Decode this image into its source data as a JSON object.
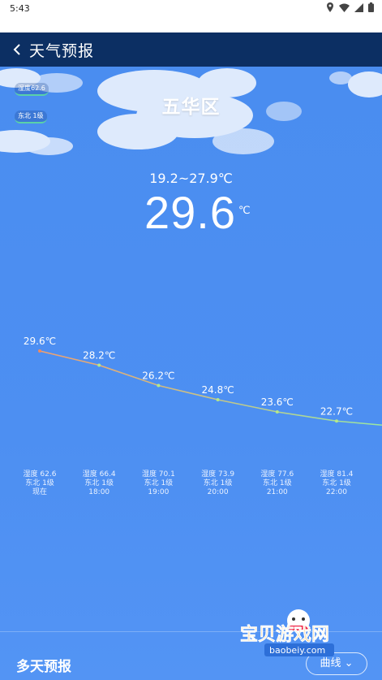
{
  "status": {
    "time": "5:43"
  },
  "header": {
    "title": "天气预报"
  },
  "weather": {
    "city": "五华区",
    "humidity_badge": "湿度62.6",
    "wind_badge": "东北 1级",
    "range": "19.2~27.9℃",
    "current": "29.6",
    "unit": "℃"
  },
  "chart_data": {
    "type": "line",
    "values": [
      29.6,
      28.2,
      26.2,
      24.8,
      23.6,
      22.7
    ],
    "point_labels": [
      "29.6℃",
      "28.2℃",
      "26.2℃",
      "24.8℃",
      "23.6℃",
      "22.7℃"
    ],
    "hours": [
      {
        "humidity": "湿度 62.6",
        "wind": "东北 1级",
        "time": "现在"
      },
      {
        "humidity": "湿度 66.4",
        "wind": "东北 1级",
        "time": "18:00"
      },
      {
        "humidity": "湿度 70.1",
        "wind": "东北 1级",
        "time": "19:00"
      },
      {
        "humidity": "湿度 73.9",
        "wind": "东北 1级",
        "time": "20:00"
      },
      {
        "humidity": "湿度 77.6",
        "wind": "东北 1级",
        "time": "21:00"
      },
      {
        "humidity": "湿度 81.4",
        "wind": "东北 1级",
        "time": "22:00"
      }
    ]
  },
  "forecast": {
    "title": "多天预报",
    "mode_label": "曲线"
  },
  "watermark": {
    "text": "宝贝游戏网",
    "url": "baobeiy.com"
  },
  "colors": {
    "titlebar": "#0c2f63",
    "sky": "#4a8df0",
    "line_start": "#f0a070",
    "line_end": "#9be8a0"
  }
}
